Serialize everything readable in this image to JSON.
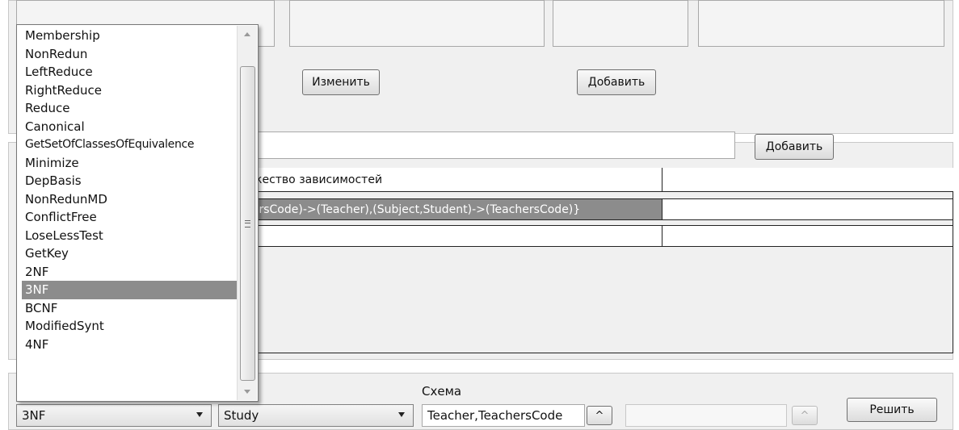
{
  "top": {
    "change_button": "Изменить",
    "add_button": "Добавить"
  },
  "dependency": {
    "add_button": "Добавить",
    "grid_header": "кество зависимостей",
    "grid_row_selected": "hersCode)->(Teacher),(Subject,Student)->(TeachersCode)}",
    "grid_row_empty": ""
  },
  "bottom": {
    "schema_label": "Схема",
    "operation_combo_value": "3NF",
    "relation_combo_value": "Study",
    "schema_input_value": "Teacher,TeachersCode",
    "caret_up": "^",
    "solve_button": "Решить"
  },
  "dropdown": {
    "items": [
      "Membership",
      "NonRedun",
      "LeftReduce",
      "RightReduce",
      "Reduce",
      "Canonical",
      "GetSetOfClassesOfEquivalence",
      "Minimize",
      "DepBasis",
      "NonRedunMD",
      "ConflictFree",
      "LoseLessTest",
      "GetKey",
      "2NF",
      "3NF",
      "BCNF",
      "ModifiedSynt",
      "4NF"
    ],
    "selected": "3NF"
  },
  "colors": {
    "selection": "#8c8c8c",
    "panel": "#f0f0f0"
  }
}
